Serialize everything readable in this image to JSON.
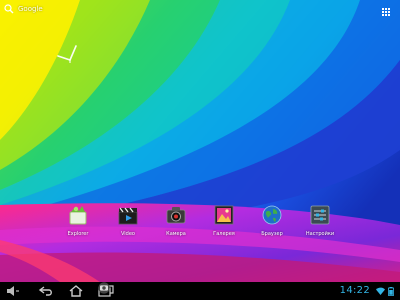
{
  "search": {
    "label": "Google"
  },
  "shortcuts": [
    {
      "label": "Explorer",
      "icon": "explorer-icon"
    },
    {
      "label": "Video",
      "icon": "video-clapper-icon"
    },
    {
      "label": "Камера",
      "icon": "camera-icon"
    },
    {
      "label": "Галерея",
      "icon": "gallery-icon"
    },
    {
      "label": "Браузер",
      "icon": "globe-icon"
    },
    {
      "label": "Настройки",
      "icon": "settings-icon"
    }
  ],
  "status": {
    "time": "14:22"
  },
  "colors": {
    "clock": "#33b5e5",
    "nav_bg": "#000000"
  }
}
